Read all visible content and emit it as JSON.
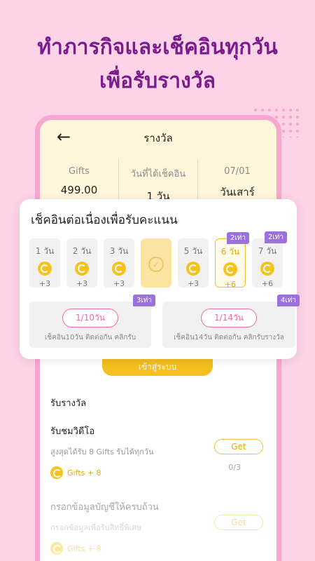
{
  "headline": {
    "line1": "ทำภารกิจและเช็คอินทุกวัน",
    "line2": "เพื่อรับรางวัล"
  },
  "screen": {
    "title": "รางวัล",
    "back_icon": "arrow-left-icon",
    "stats": [
      {
        "label": "Gifts",
        "value": "499.00"
      },
      {
        "label": "วันที่ได้เช็คอิน",
        "value": "1 วัน"
      },
      {
        "label": "07/01",
        "value": "วันเสาร์"
      }
    ]
  },
  "modal": {
    "title": "เช็คอินต่อเนื่องเพื่อรับคะแนน",
    "days": [
      {
        "label": "1 วัน",
        "points": "+3",
        "state": "normal",
        "badge": ""
      },
      {
        "label": "2 วัน",
        "points": "+3",
        "state": "normal",
        "badge": ""
      },
      {
        "label": "3 วัน",
        "points": "+3",
        "state": "normal",
        "badge": ""
      },
      {
        "label": "",
        "points": "",
        "state": "done",
        "badge": ""
      },
      {
        "label": "5 วัน",
        "points": "+3",
        "state": "normal",
        "badge": ""
      },
      {
        "label": "6 วัน",
        "points": "+6",
        "state": "today",
        "badge": "2เท่า"
      },
      {
        "label": "7 วัน",
        "points": "+6",
        "state": "normal",
        "badge": "2เท่า"
      }
    ],
    "streaks": [
      {
        "pill": "1/10วัน",
        "desc": "เช็คอิน10วัน ติดต่อกัน คลิกรับ",
        "badge": "3เท่า"
      },
      {
        "pill": "1/14วัน",
        "desc": "เช็คอิน14วัน ติดต่อกัน คลิกรับรางวัล",
        "badge": "4เท่า"
      }
    ]
  },
  "login_button": "เข้าสู่ระบบ",
  "rewards": {
    "section_title": "รับรางวัล",
    "tasks": [
      {
        "title": "รับชมวิดีโอ",
        "desc": "สูงสุดได้รับ 8 Gifts รับได้ทุกวัน",
        "reward": "Gifts + 8",
        "button": "Get",
        "progress": "0/3"
      },
      {
        "title": "กรอกข้อมูลบัญชีให้ครบถ้วน",
        "desc": "กรอกข้อมูลเพื่อรับสิทธิ์พิเศษ",
        "reward": "Gifts + 8",
        "button": "Get",
        "progress": ""
      }
    ]
  },
  "colors": {
    "background": "#fdd3e8",
    "headline": "#7a1d8c",
    "accent": "#f5bf1e",
    "badge": "#9b71e0",
    "pink": "#ec6aa5"
  }
}
